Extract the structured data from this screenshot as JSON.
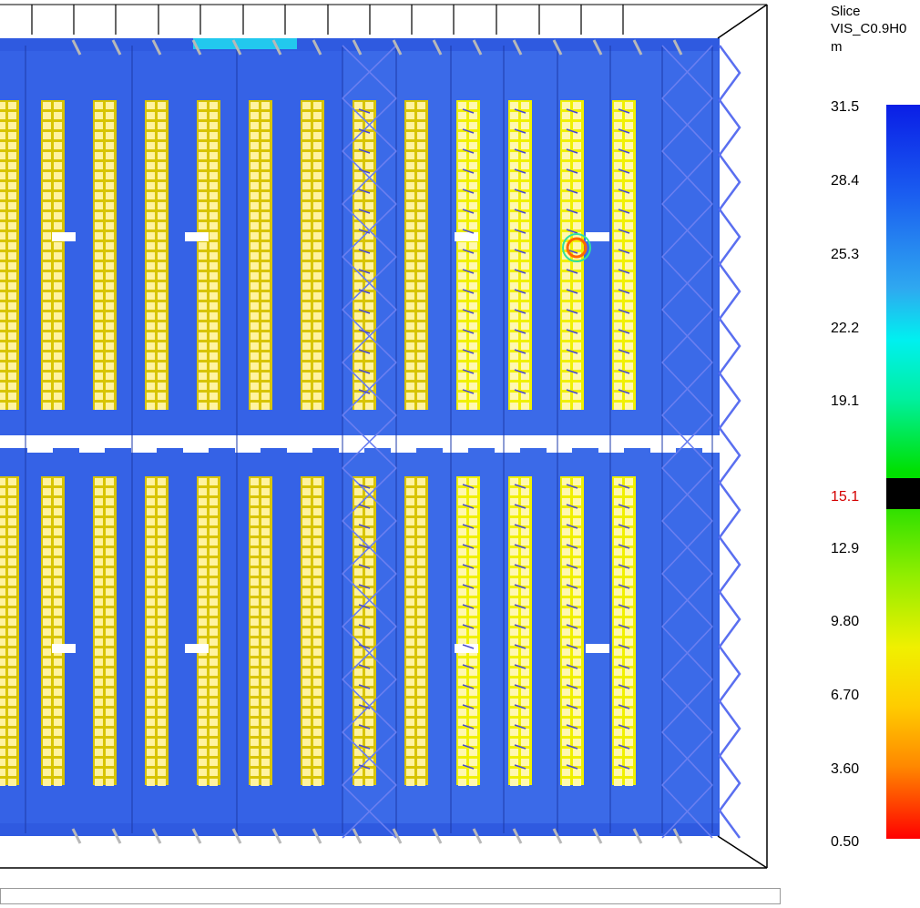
{
  "viewer": {
    "colorbar": {
      "title_line1": "Slice",
      "title_line2": "VIS_C0.9H0",
      "title_line3": "m",
      "ticks": [
        "31.5",
        "28.4",
        "25.3",
        "22.2",
        "19.1",
        "15.1",
        "12.9",
        "9.80",
        "6.70",
        "3.60",
        "0.50"
      ],
      "highlight_tick": "15.1",
      "colors": {
        "top": "#0a1ee6",
        "mid": "#00e000",
        "bottom": "#ff0000",
        "highlight_band": "#000000",
        "highlight_label": "#d40000"
      }
    },
    "scene": {
      "floor_color": "#3562e6",
      "rack_color": "#fff3a0",
      "rack_frame_color": "#d8c400"
    }
  }
}
